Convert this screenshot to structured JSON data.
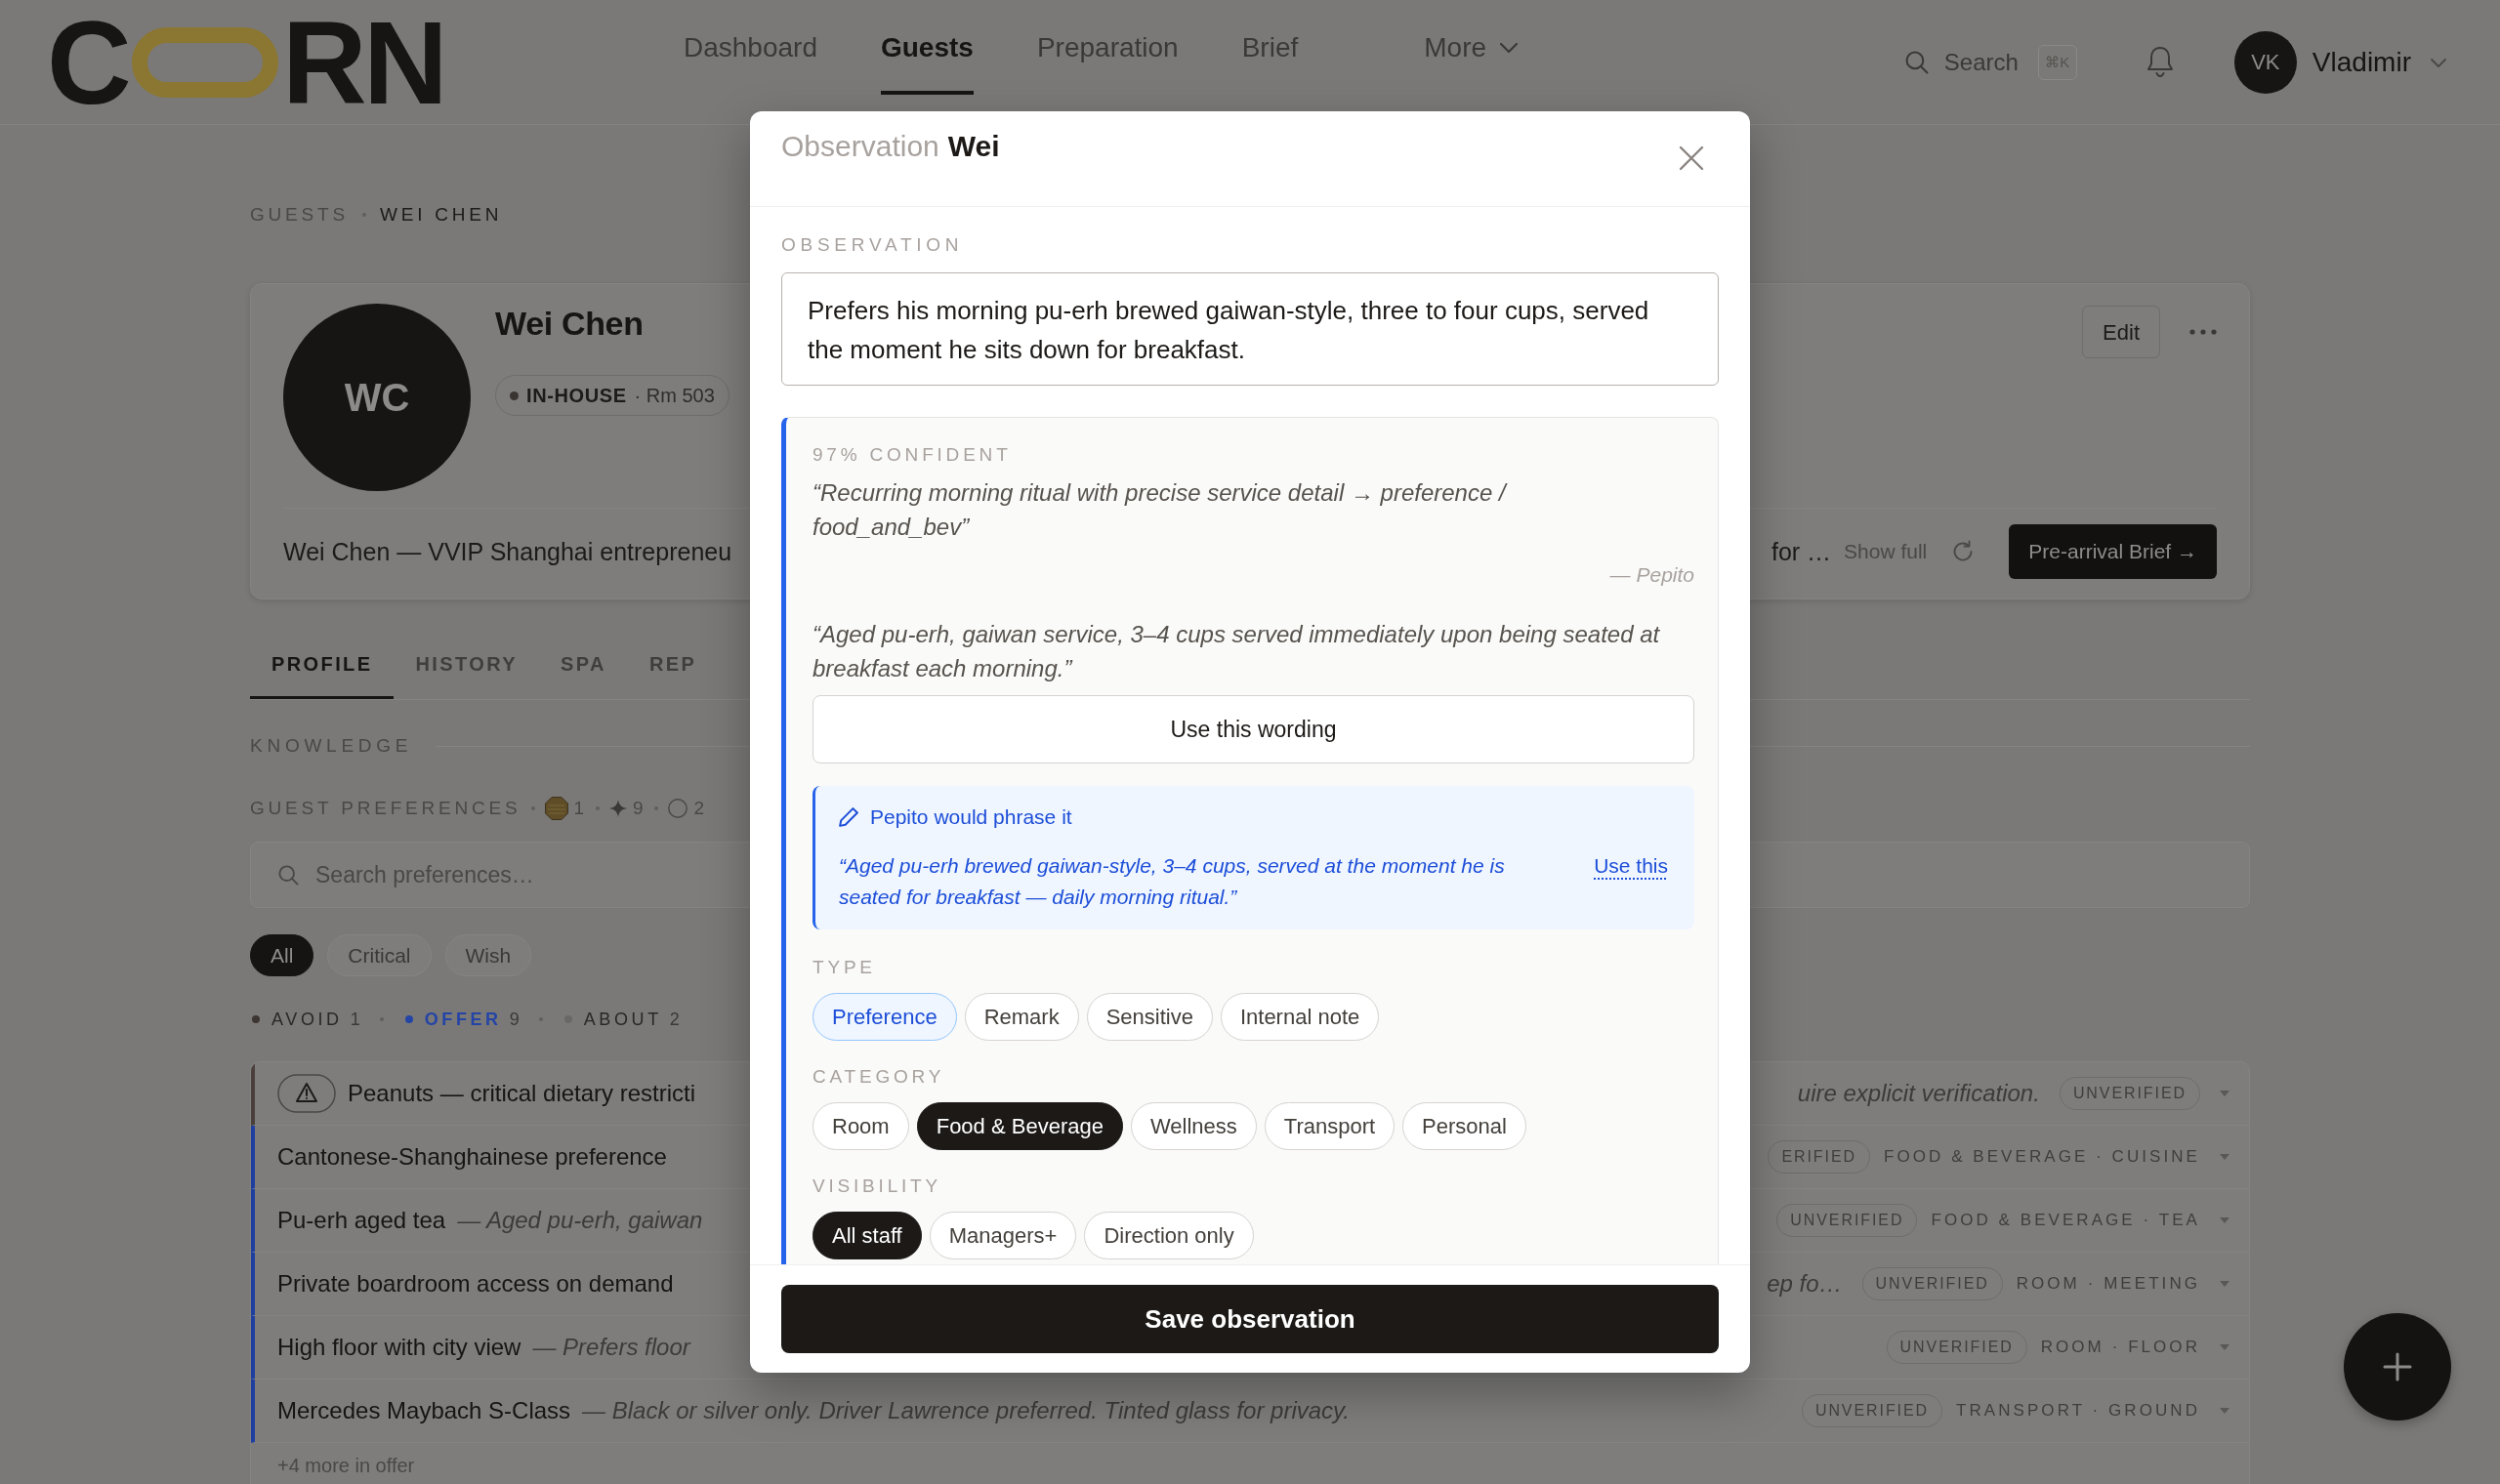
{
  "header": {
    "brand": {
      "lead": "C",
      "tail": "RN"
    },
    "nav": [
      {
        "label": "Dashboard",
        "selected": false,
        "kind": "link"
      },
      {
        "label": "Guests",
        "selected": true,
        "kind": "link"
      },
      {
        "label": "Preparation",
        "selected": false,
        "kind": "link"
      },
      {
        "label": "Brief",
        "selected": false,
        "kind": "link"
      },
      {
        "label": "More",
        "selected": false,
        "kind": "menu"
      }
    ],
    "search": {
      "label": "Search",
      "shortcut": "⌘K"
    },
    "user": {
      "initials": "VK",
      "name": "Vladimir"
    }
  },
  "breadcrumb": [
    {
      "label": "GUESTS",
      "current": false
    },
    {
      "label": "WEI CHEN",
      "current": true
    }
  ],
  "profile": {
    "initials": "WC",
    "name": "Wei Chen",
    "badge": {
      "status": "IN-HOUSE",
      "room": "· Rm 503"
    },
    "edit_button": "Edit",
    "summary_start": "Wei Chen — VVIP Shanghai entrepreneu",
    "summary_end": "for …",
    "show_full": "Show full",
    "brief_button": "Pre-arrival Brief →"
  },
  "tabs": [
    {
      "label": "PROFILE",
      "selected": true
    },
    {
      "label": "HISTORY",
      "selected": false
    },
    {
      "label": "SPA",
      "selected": false
    },
    {
      "label": "REP",
      "selected": false
    }
  ],
  "knowledge": {
    "heading": "KNOWLEDGE",
    "title": "GUEST PREFERENCES",
    "counts": [
      {
        "kind": "octagon",
        "value": "1"
      },
      {
        "kind": "sparkle",
        "value": "9"
      },
      {
        "kind": "circle",
        "value": "2"
      }
    ],
    "search": {
      "placeholder": "Search preferences…"
    },
    "filters": [
      {
        "label": "All",
        "selected": true
      },
      {
        "label": "Critical",
        "selected": false
      },
      {
        "label": "Wish",
        "selected": false
      }
    ],
    "groups": [
      {
        "label": "AVOID",
        "count": "1",
        "selected": false,
        "color": "#3d3532"
      },
      {
        "label": "OFFER",
        "count": "9",
        "selected": true,
        "color": "#2444a6"
      },
      {
        "label": "ABOUT",
        "count": "2",
        "selected": false,
        "color": "#6a6866"
      }
    ],
    "items": [
      {
        "kind": "critical",
        "title": "Peanuts — critical dietary restricti",
        "note_tail": "uire explicit verification.",
        "status": "UNVERIFIED"
      },
      {
        "kind": "offer",
        "title": "Cantonese-Shanghainese preference",
        "status": "ERIFIED",
        "category": "FOOD & BEVERAGE · CUISINE"
      },
      {
        "kind": "offer",
        "title": "Pu-erh aged tea",
        "note": "— Aged pu-erh, gaiwan",
        "status": "UNVERIFIED",
        "category": "FOOD & BEVERAGE · TEA"
      },
      {
        "kind": "offer",
        "title": "Private boardroom access on demand",
        "note_tail": "ep fo…",
        "status": "UNVERIFIED",
        "category": "ROOM · MEETING"
      },
      {
        "kind": "offer",
        "title": "High floor with city view",
        "note": "— Prefers floor",
        "status": "UNVERIFIED",
        "category": "ROOM · FLOOR"
      },
      {
        "kind": "offer",
        "title": "Mercedes Maybach S-Class",
        "note": "— Black or silver only. Driver Lawrence preferred. Tinted glass for privacy.",
        "status": "UNVERIFIED",
        "category": "TRANSPORT · GROUND"
      }
    ],
    "more": "+4 more in offer"
  },
  "modal": {
    "title": "Observation",
    "subject": "Wei",
    "field_label": "OBSERVATION",
    "observation": "Prefers his morning pu-erh brewed gaiwan-style, three to four cups, served the moment he sits down for breakfast.",
    "suggestion": {
      "confidence": "97% CONFIDENT",
      "reasoning": "“Recurring morning ritual with precise service detail → preference / food_and_bev”",
      "author": "— Pepito",
      "wording": "“Aged pu-erh, gaiwan service, 3–4 cups served immediately upon being seated at breakfast each morning.”",
      "use_wording_button": "Use this wording",
      "rephrase": {
        "heading": "Pepito would phrase it",
        "text": "“Aged pu-erh brewed gaiwan-style, 3–4 cups, served at the moment he is seated for breakfast — daily morning ritual.”",
        "action": "Use this"
      }
    },
    "option_groups": [
      {
        "label": "TYPE",
        "kind": "accent",
        "options": [
          {
            "label": "Preference",
            "selected": true
          },
          {
            "label": "Remark",
            "selected": false
          },
          {
            "label": "Sensitive",
            "selected": false
          },
          {
            "label": "Internal note",
            "selected": false
          }
        ]
      },
      {
        "label": "CATEGORY",
        "kind": "solid",
        "options": [
          {
            "label": "Room",
            "selected": false
          },
          {
            "label": "Food & Beverage",
            "selected": true
          },
          {
            "label": "Wellness",
            "selected": false
          },
          {
            "label": "Transport",
            "selected": false
          },
          {
            "label": "Personal",
            "selected": false
          }
        ]
      },
      {
        "label": "VISIBILITY",
        "kind": "solid",
        "options": [
          {
            "label": "All staff",
            "selected": true
          },
          {
            "label": "Managers+",
            "selected": false
          },
          {
            "label": "Direction only",
            "selected": false
          }
        ]
      }
    ],
    "save_button": "Save observation"
  }
}
